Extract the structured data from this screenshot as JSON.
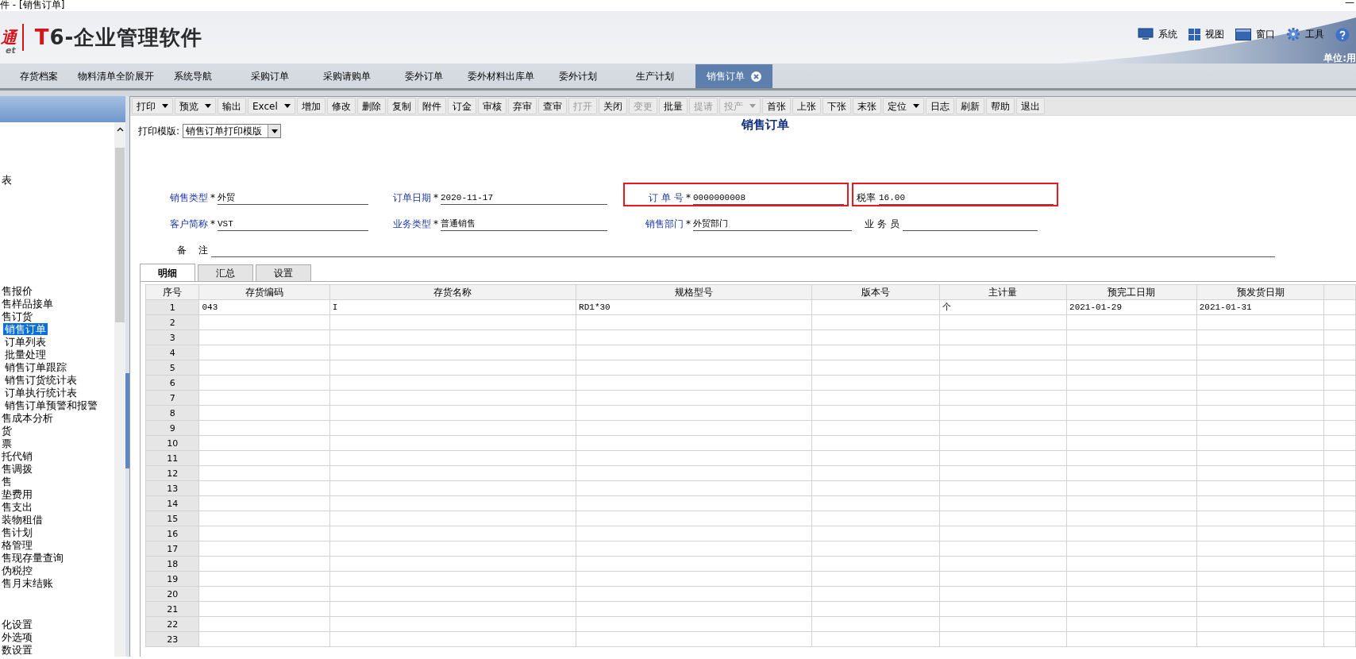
{
  "window": {
    "title": "件 - [销售订单]",
    "minimize": "—"
  },
  "header": {
    "logo_fragment": "通",
    "logo_sub": "et",
    "product_mark": "T",
    "product_name": "6-企业管理软件",
    "menu": [
      {
        "label": "系统"
      },
      {
        "label": "视图"
      },
      {
        "label": "窗口"
      },
      {
        "label": "工具"
      }
    ],
    "unit": "单位:用"
  },
  "tabs": [
    {
      "label": "存货档案",
      "selected": false
    },
    {
      "label": "物料清单全阶展开",
      "selected": false
    },
    {
      "label": "系统导航",
      "selected": false
    },
    {
      "label": "采购订单",
      "selected": false
    },
    {
      "label": "采购请购单",
      "selected": false
    },
    {
      "label": "委外订单",
      "selected": false
    },
    {
      "label": "委外材料出库单",
      "selected": false
    },
    {
      "label": "委外计划",
      "selected": false
    },
    {
      "label": "生产计划",
      "selected": false
    },
    {
      "label": "销售订单",
      "selected": true
    }
  ],
  "sidebar": {
    "groups": [
      {
        "items": [
          {
            "label": "表",
            "selected": false
          }
        ]
      },
      {
        "items": [
          {
            "label": "售报价",
            "selected": false
          },
          {
            "label": "售样品接单",
            "selected": false
          },
          {
            "label": "售订货",
            "selected": false,
            "children": [
              {
                "label": "销售订单",
                "selected": true
              },
              {
                "label": "订单列表",
                "selected": false
              },
              {
                "label": "批量处理",
                "selected": false
              },
              {
                "label": "销售订单跟踪",
                "selected": false
              },
              {
                "label": "销售订货统计表",
                "selected": false
              },
              {
                "label": "订单执行统计表",
                "selected": false
              },
              {
                "label": "销售订单预警和报警",
                "selected": false
              }
            ]
          },
          {
            "label": "售成本分析",
            "selected": false
          },
          {
            "label": "货",
            "selected": false
          },
          {
            "label": "票",
            "selected": false
          },
          {
            "label": "托代销",
            "selected": false
          },
          {
            "label": "售调拨",
            "selected": false
          },
          {
            "label": "售",
            "selected": false
          },
          {
            "label": "垫费用",
            "selected": false
          },
          {
            "label": "售支出",
            "selected": false
          },
          {
            "label": "装物租借",
            "selected": false
          },
          {
            "label": "售计划",
            "selected": false
          },
          {
            "label": "格管理",
            "selected": false
          },
          {
            "label": "售现存量查询",
            "selected": false
          },
          {
            "label": "伪税控",
            "selected": false
          },
          {
            "label": "售月末结账",
            "selected": false
          }
        ]
      },
      {
        "items": [
          {
            "label": "化设置",
            "selected": false
          },
          {
            "label": "外选项",
            "selected": false
          },
          {
            "label": "数设置",
            "selected": false
          }
        ]
      }
    ]
  },
  "toolbar": [
    {
      "label": "打印",
      "menu": true,
      "disabled": false
    },
    {
      "label": "预览",
      "menu": true,
      "disabled": false
    },
    {
      "label": "输出",
      "menu": false,
      "disabled": false
    },
    {
      "label": "Excel",
      "menu": true,
      "disabled": false
    },
    {
      "label": "增加",
      "menu": false,
      "disabled": false
    },
    {
      "label": "修改",
      "menu": false,
      "disabled": false
    },
    {
      "label": "删除",
      "menu": false,
      "disabled": false
    },
    {
      "label": "复制",
      "menu": false,
      "disabled": false
    },
    {
      "label": "附件",
      "menu": false,
      "disabled": false
    },
    {
      "label": "订金",
      "menu": false,
      "disabled": false
    },
    {
      "label": "审核",
      "menu": false,
      "disabled": false
    },
    {
      "label": "弃审",
      "menu": false,
      "disabled": false
    },
    {
      "label": "查审",
      "menu": false,
      "disabled": false
    },
    {
      "label": "打开",
      "menu": false,
      "disabled": true
    },
    {
      "label": "关闭",
      "menu": false,
      "disabled": false
    },
    {
      "label": "变更",
      "menu": false,
      "disabled": true
    },
    {
      "label": "批量",
      "menu": false,
      "disabled": false
    },
    {
      "label": "提请",
      "menu": false,
      "disabled": true
    },
    {
      "label": "投产",
      "menu": true,
      "disabled": true
    },
    {
      "label": "首张",
      "menu": false,
      "disabled": false
    },
    {
      "label": "上张",
      "menu": false,
      "disabled": false
    },
    {
      "label": "下张",
      "menu": false,
      "disabled": false
    },
    {
      "label": "末张",
      "menu": false,
      "disabled": false
    },
    {
      "label": "定位",
      "menu": true,
      "disabled": false
    },
    {
      "label": "日志",
      "menu": false,
      "disabled": false
    },
    {
      "label": "刷新",
      "menu": false,
      "disabled": false
    },
    {
      "label": "帮助",
      "menu": false,
      "disabled": false
    },
    {
      "label": "退出",
      "menu": false,
      "disabled": false
    }
  ],
  "form": {
    "template_label": "打印模版:",
    "template_value": "销售订单打印模版",
    "title": "销售订单",
    "rows": [
      [
        {
          "label": "销售类型",
          "required": true,
          "mark": "*",
          "value": "外贸",
          "highlighted": false
        },
        {
          "label": "订单日期",
          "required": true,
          "mark": "*",
          "value": "2020-11-17",
          "highlighted": false
        },
        {
          "label": "订 单 号",
          "required": true,
          "mark": "*",
          "value": "0000000008",
          "highlighted": true
        },
        {
          "label": "税率",
          "required": false,
          "value": "16.00",
          "highlighted": true
        }
      ],
      [
        {
          "label": "客户简称",
          "required": true,
          "mark": "*",
          "value": "VST",
          "highlighted": false
        },
        {
          "label": "业务类型",
          "required": true,
          "mark": "*",
          "value": "普通销售",
          "highlighted": false
        },
        {
          "label": "销售部门",
          "required": true,
          "mark": "*",
          "value": "外贸部门",
          "highlighted": false
        },
        {
          "label": "业 务 员",
          "required": false,
          "highlighted": false
        }
      ],
      [
        {
          "label": "备    注",
          "required": false,
          "highlighted": false
        }
      ]
    ]
  },
  "subtabs": [
    {
      "label": "明细",
      "selected": true
    },
    {
      "label": "汇总",
      "selected": false
    },
    {
      "label": "设置",
      "selected": false
    }
  ],
  "table": {
    "columns": [
      "序号",
      "存货编码",
      "存货名称",
      "规格型号",
      "版本号",
      "主计量",
      "预完工日期",
      "预发货日期"
    ],
    "rows": [
      {
        "no": "1",
        "code": "043",
        "name": "I",
        "spec": "RD1*30",
        "unit": "个",
        "finish_date": "2021-01-29",
        "ship_date": "2021-01-31"
      },
      {
        "no": "2"
      },
      {
        "no": "3"
      },
      {
        "no": "4"
      },
      {
        "no": "5"
      },
      {
        "no": "6"
      },
      {
        "no": "7"
      },
      {
        "no": "8"
      },
      {
        "no": "9"
      },
      {
        "no": "10"
      },
      {
        "no": "11"
      },
      {
        "no": "12"
      },
      {
        "no": "13"
      },
      {
        "no": "14"
      },
      {
        "no": "15"
      },
      {
        "no": "16"
      },
      {
        "no": "17"
      },
      {
        "no": "18"
      },
      {
        "no": "19"
      },
      {
        "no": "20"
      },
      {
        "no": "21"
      },
      {
        "no": "22"
      },
      {
        "no": "23"
      }
    ]
  }
}
